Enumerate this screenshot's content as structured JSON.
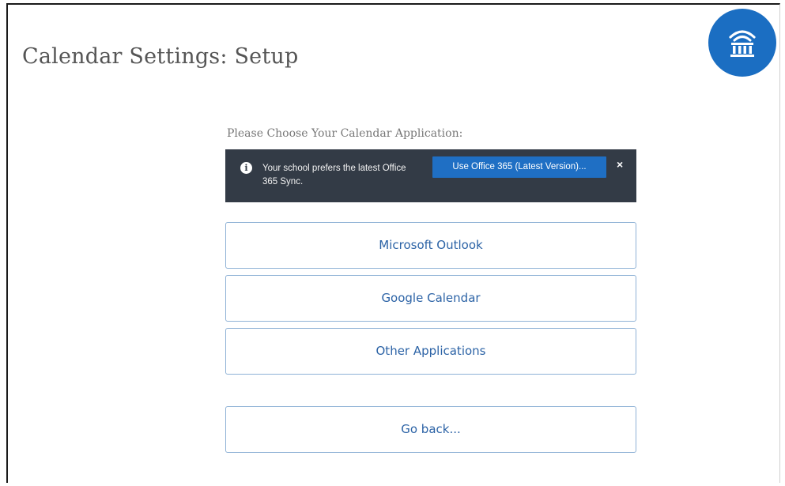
{
  "header": {
    "title": "Calendar Settings: Setup",
    "logo_icon": "institution-icon",
    "logo_color": "#1b6ec2"
  },
  "prompt": "Please Choose Your Calendar Application:",
  "alert": {
    "icon": "info-icon",
    "message": "Your school prefers the latest Office 365 Sync.",
    "action_label": "Use Office 365 (Latest Version)...",
    "close_label": "×",
    "background": "#333b46"
  },
  "options": [
    {
      "label": "Microsoft Outlook"
    },
    {
      "label": "Google Calendar"
    },
    {
      "label": "Other Applications"
    }
  ],
  "back_label": "Go back...",
  "colors": {
    "accent": "#1f6fc4",
    "option_text": "#2c63a6",
    "option_border": "#8fb2d6"
  }
}
